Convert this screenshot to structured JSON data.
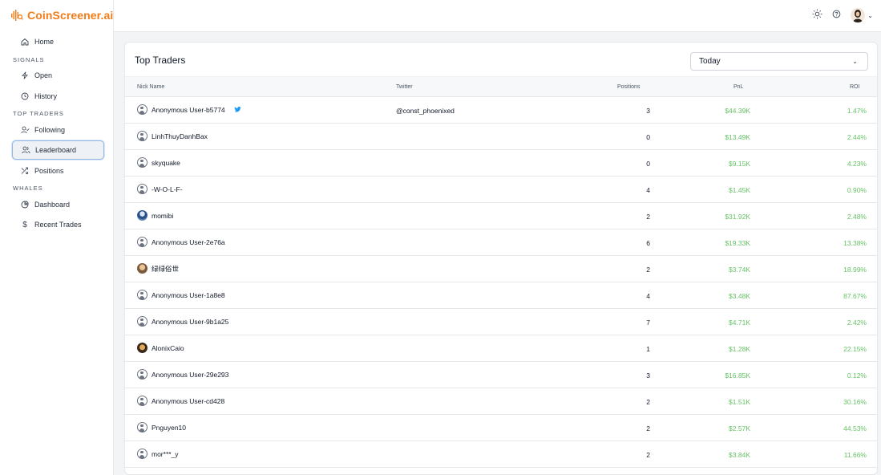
{
  "app": {
    "logo_text": "CoinScreener.ai"
  },
  "sidebar": {
    "home": {
      "label": "Home",
      "icon": "home-icon"
    },
    "sections": [
      {
        "label": "SIGNALS",
        "items": [
          {
            "label": "Open",
            "icon": "bolt-icon"
          },
          {
            "label": "History",
            "icon": "clock-icon"
          }
        ]
      },
      {
        "label": "TOP TRADERS",
        "items": [
          {
            "label": "Following",
            "icon": "user-check-icon"
          },
          {
            "label": "Leaderboard",
            "icon": "users-icon",
            "active": true
          },
          {
            "label": "Positions",
            "icon": "shuffle-icon"
          }
        ]
      },
      {
        "label": "WHALES",
        "items": [
          {
            "label": "Dashboard",
            "icon": "pie-chart-icon"
          },
          {
            "label": "Recent Trades",
            "icon": "dollar-icon"
          }
        ]
      }
    ]
  },
  "topbar": {
    "icons": [
      "sun-icon",
      "help-icon",
      "avatar"
    ]
  },
  "card": {
    "title": "Top Traders",
    "filter": {
      "selected": "Today"
    },
    "columns": {
      "nick": "Nick Name",
      "twitter": "Twitter",
      "positions": "Positions",
      "pnl": "PnL",
      "roi": "ROI"
    },
    "rows": [
      {
        "nick": "Anonymous User-b5774",
        "avatar": "default",
        "twitter_badge": true,
        "twitter": "@const_phoenixed",
        "positions": "3",
        "pnl": "$44.39K",
        "roi": "1.47%"
      },
      {
        "nick": "LinhThuyDanhBax",
        "avatar": "default",
        "twitter_badge": false,
        "twitter": "",
        "positions": "0",
        "pnl": "$13.49K",
        "roi": "2.44%"
      },
      {
        "nick": "skyquake",
        "avatar": "default",
        "twitter_badge": false,
        "twitter": "",
        "positions": "0",
        "pnl": "$9.15K",
        "roi": "4.23%"
      },
      {
        "nick": "-W-O-L-F-",
        "avatar": "default",
        "twitter_badge": false,
        "twitter": "",
        "positions": "4",
        "pnl": "$1.45K",
        "roi": "0.90%"
      },
      {
        "nick": "momibi",
        "avatar": "photo1",
        "twitter_badge": false,
        "twitter": "",
        "positions": "2",
        "pnl": "$31.92K",
        "roi": "2.48%"
      },
      {
        "nick": "Anonymous User-2e76a",
        "avatar": "default",
        "twitter_badge": false,
        "twitter": "",
        "positions": "6",
        "pnl": "$19.33K",
        "roi": "13.38%"
      },
      {
        "nick": "绿绿俗世",
        "avatar": "photo2",
        "twitter_badge": false,
        "twitter": "",
        "positions": "2",
        "pnl": "$3.74K",
        "roi": "18.99%"
      },
      {
        "nick": "Anonymous User-1a8e8",
        "avatar": "default",
        "twitter_badge": false,
        "twitter": "",
        "positions": "4",
        "pnl": "$3.48K",
        "roi": "87.67%"
      },
      {
        "nick": "Anonymous User-9b1a25",
        "avatar": "default",
        "twitter_badge": false,
        "twitter": "",
        "positions": "7",
        "pnl": "$4.71K",
        "roi": "2.42%"
      },
      {
        "nick": "AlonixCaio",
        "avatar": "photo3",
        "twitter_badge": false,
        "twitter": "",
        "positions": "1",
        "pnl": "$1.28K",
        "roi": "22.15%"
      },
      {
        "nick": "Anonymous User-29e293",
        "avatar": "default",
        "twitter_badge": false,
        "twitter": "",
        "positions": "3",
        "pnl": "$16.85K",
        "roi": "0.12%"
      },
      {
        "nick": "Anonymous User-cd428",
        "avatar": "default",
        "twitter_badge": false,
        "twitter": "",
        "positions": "2",
        "pnl": "$1.51K",
        "roi": "30.16%"
      },
      {
        "nick": "Pnguyen10",
        "avatar": "default",
        "twitter_badge": false,
        "twitter": "",
        "positions": "2",
        "pnl": "$2.57K",
        "roi": "44.53%"
      },
      {
        "nick": "mor***_y",
        "avatar": "default",
        "twitter_badge": false,
        "twitter": "",
        "positions": "2",
        "pnl": "$3.84K",
        "roi": "11.66%"
      }
    ]
  },
  "colors": {
    "brand": "#f07d1a",
    "positive": "#66c266",
    "active_border": "#93b8e6",
    "twitter": "#1d9bf0"
  }
}
